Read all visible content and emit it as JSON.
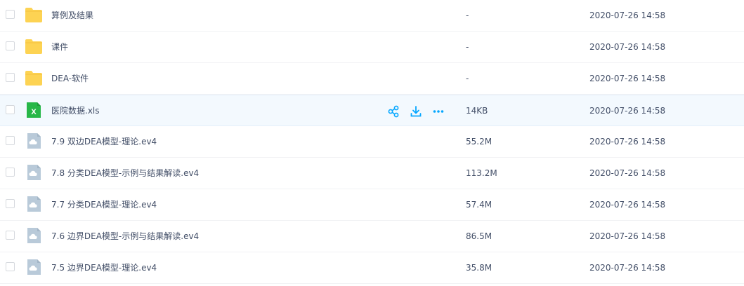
{
  "files": [
    {
      "type": "folder",
      "name": "算例及结果",
      "size": "-",
      "date": "2020-07-26 14:58"
    },
    {
      "type": "folder",
      "name": "课件",
      "size": "-",
      "date": "2020-07-26 14:58"
    },
    {
      "type": "folder",
      "name": "DEA-软件",
      "size": "-",
      "date": "2020-07-26 14:58"
    },
    {
      "type": "excel",
      "name": "医院数据.xls",
      "size": "14KB",
      "date": "2020-07-26 14:58",
      "hover": true,
      "icon_letter": "X"
    },
    {
      "type": "video",
      "name": "7.9 双边DEA模型-理论.ev4",
      "size": "55.2M",
      "date": "2020-07-26 14:58"
    },
    {
      "type": "video",
      "name": "7.8 分类DEA模型-示例与结果解读.ev4",
      "size": "113.2M",
      "date": "2020-07-26 14:58"
    },
    {
      "type": "video",
      "name": "7.7 分类DEA模型-理论.ev4",
      "size": "57.4M",
      "date": "2020-07-26 14:58"
    },
    {
      "type": "video",
      "name": "7.6 边界DEA模型-示例与结果解读.ev4",
      "size": "86.5M",
      "date": "2020-07-26 14:58"
    },
    {
      "type": "video",
      "name": "7.5 边界DEA模型-理论.ev4",
      "size": "35.8M",
      "date": "2020-07-26 14:58"
    }
  ],
  "colors": {
    "folder": "#fdd353",
    "folder_tab": "#f5c23c",
    "excel": "#27b748",
    "video": "#b9cad9",
    "accent": "#06a7ff",
    "text": "#424e67"
  },
  "row_actions": [
    "share-icon",
    "download-icon",
    "more-icon"
  ]
}
